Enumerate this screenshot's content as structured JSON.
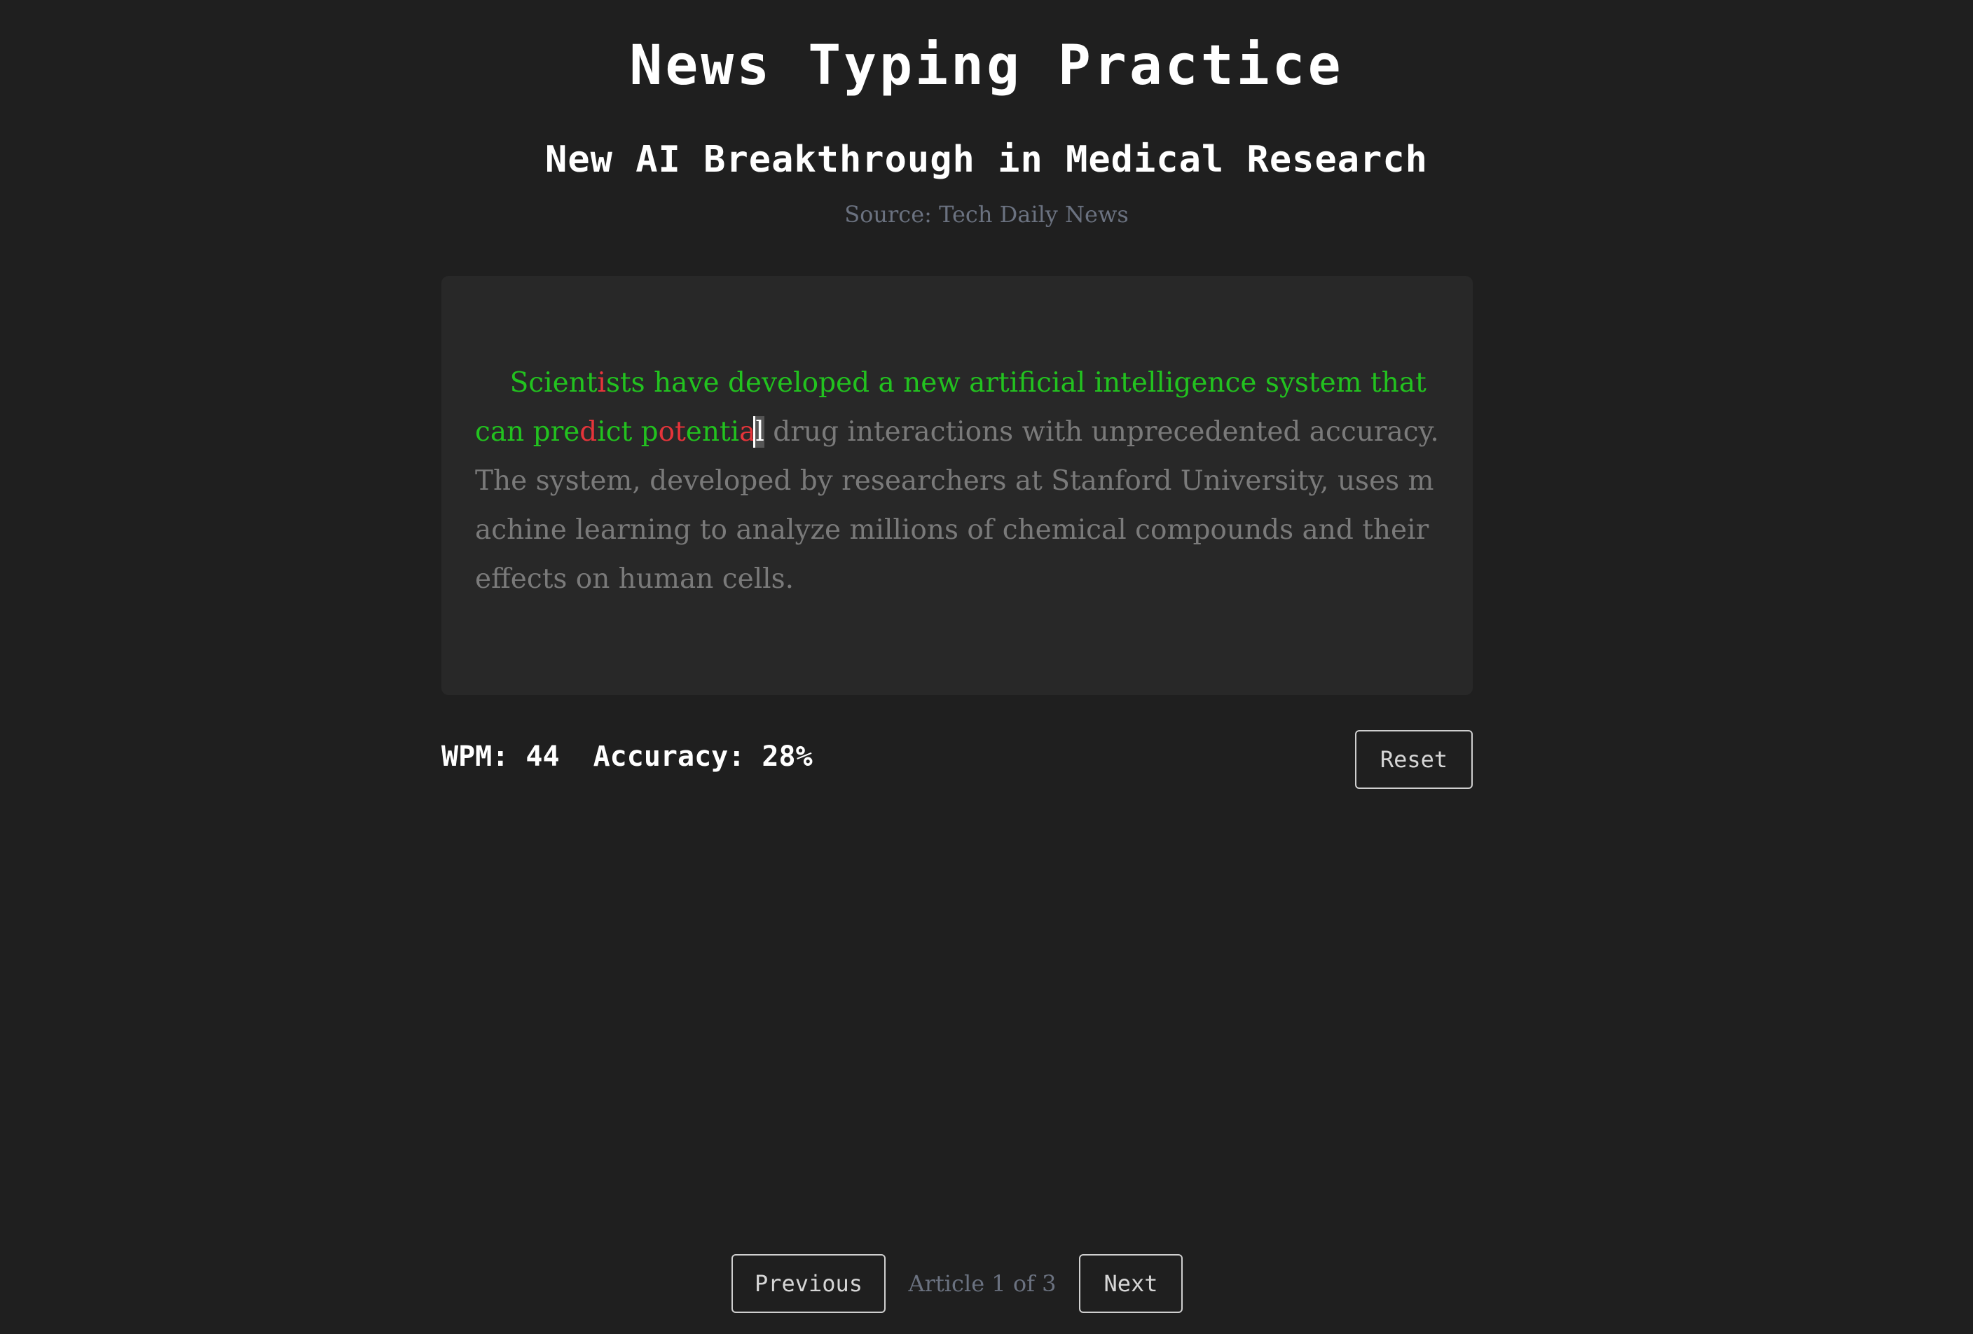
{
  "header": {
    "title": "News Typing Practice"
  },
  "article": {
    "title": "New AI Breakthrough in Medical Research",
    "source": "Source: Tech Daily News",
    "segments": [
      {
        "text": "Scient",
        "state": "correct"
      },
      {
        "text": "i",
        "state": "wrong"
      },
      {
        "text": "sts have developed a new artificial intelligence system that can pre",
        "state": "correct"
      },
      {
        "text": "d",
        "state": "wrong"
      },
      {
        "text": "ict p",
        "state": "correct"
      },
      {
        "text": "ot",
        "state": "wrong"
      },
      {
        "text": "enti",
        "state": "correct"
      },
      {
        "text": "a",
        "state": "wrong"
      },
      {
        "text": "l",
        "state": "current"
      },
      {
        "text": " drug interactions with unprecedented accuracy. The system, developed by researchers at Stanford University, uses machine learning to analyze millions of chemical compounds and their effects on human cells.",
        "state": "pending"
      }
    ]
  },
  "stats": {
    "wpm_label": "WPM: 44",
    "accuracy_label": "Accuracy: 28%"
  },
  "controls": {
    "reset_label": "Reset",
    "previous_label": "Previous",
    "next_label": "Next",
    "pager_label": "Article 1 of 3"
  },
  "colors": {
    "background": "#1f1f1f",
    "panel": "#282828",
    "correct": "#22c21f",
    "wrong": "#e5343a",
    "pending": "#7a7a7a",
    "muted": "#6b7280"
  }
}
